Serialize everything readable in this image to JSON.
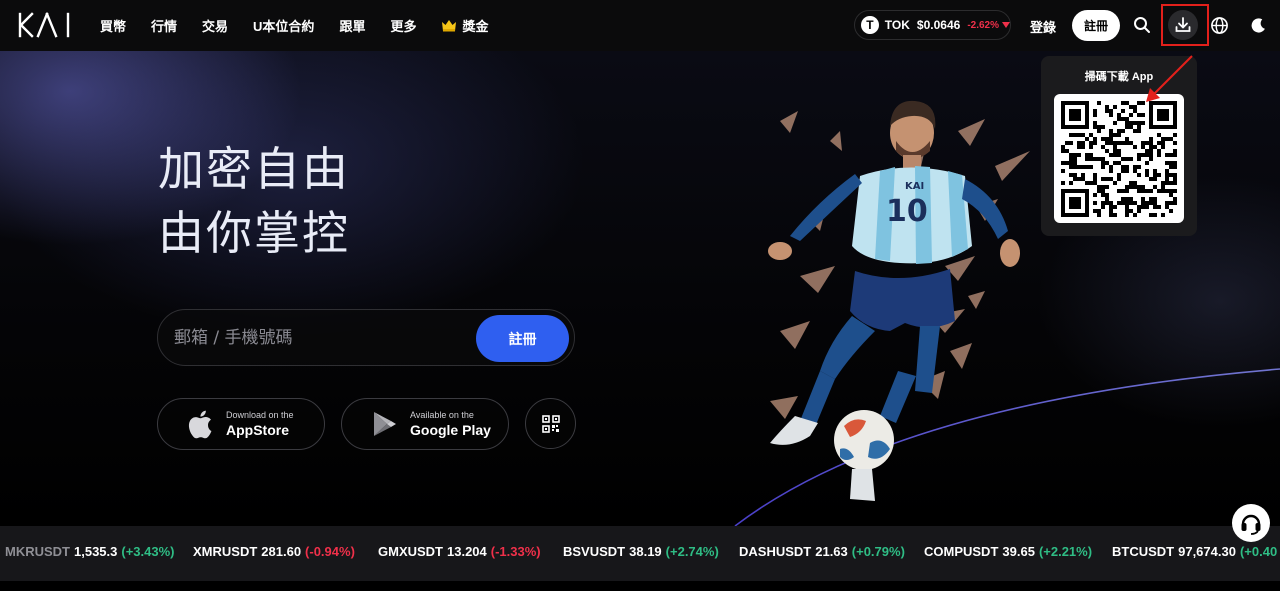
{
  "nav": {
    "logo_text": "KAI",
    "menu": [
      "買幣",
      "行情",
      "交易",
      "U本位合約",
      "跟單",
      "更多",
      "獎金"
    ],
    "token": {
      "symbol": "TOK",
      "price": "$0.0646",
      "change": "-2.62%"
    },
    "login_label": "登錄",
    "signup_label": "註冊",
    "icons": [
      "search-icon",
      "download-icon",
      "globe-icon",
      "moon-icon"
    ]
  },
  "hero": {
    "title_line1": "加密自由",
    "title_line2": "由你掌控",
    "input_placeholder": "郵箱 / 手機號碼",
    "signup_button": "註冊",
    "appstore": {
      "small": "Download on the",
      "big": "AppStore"
    },
    "googleplay": {
      "small": "Available on the",
      "big": "Google Play"
    },
    "player_jersey_number": "10",
    "player_jersey_brand": "KAI"
  },
  "popup": {
    "title": "掃碼下載 App"
  },
  "ticker": [
    {
      "symbol": "MKRUSDT",
      "price": "1,535.3",
      "change": "(+3.43%)",
      "dir": "up"
    },
    {
      "symbol": "XMRUSDT",
      "price": "281.60",
      "change": "(-0.94%)",
      "dir": "down"
    },
    {
      "symbol": "GMXUSDT",
      "price": "13.204",
      "change": "(-1.33%)",
      "dir": "down"
    },
    {
      "symbol": "BSVUSDT",
      "price": "38.19",
      "change": "(+2.74%)",
      "dir": "up"
    },
    {
      "symbol": "DASHUSDT",
      "price": "21.63",
      "change": "(+0.79%)",
      "dir": "up"
    },
    {
      "symbol": "COMPUSDT",
      "price": "39.65",
      "change": "(+2.21%)",
      "dir": "up"
    },
    {
      "symbol": "BTCUSDT",
      "price": "97,674.30",
      "change": "(+0.40",
      "dir": "up"
    }
  ],
  "colors": {
    "accent_blue": "#2f5ff0",
    "up_green": "#2fbd85",
    "down_red": "#f0304a",
    "highlight_red": "#e3201b"
  }
}
